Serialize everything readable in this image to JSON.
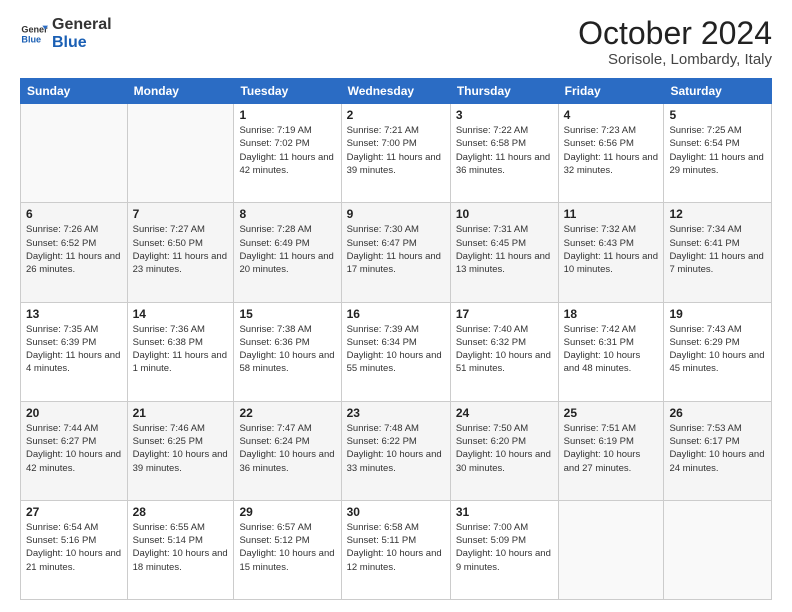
{
  "logo": {
    "line1": "General",
    "line2": "Blue"
  },
  "title": "October 2024",
  "location": "Sorisole, Lombardy, Italy",
  "headers": [
    "Sunday",
    "Monday",
    "Tuesday",
    "Wednesday",
    "Thursday",
    "Friday",
    "Saturday"
  ],
  "weeks": [
    [
      {
        "day": "",
        "info": ""
      },
      {
        "day": "",
        "info": ""
      },
      {
        "day": "1",
        "info": "Sunrise: 7:19 AM\nSunset: 7:02 PM\nDaylight: 11 hours and 42 minutes."
      },
      {
        "day": "2",
        "info": "Sunrise: 7:21 AM\nSunset: 7:00 PM\nDaylight: 11 hours and 39 minutes."
      },
      {
        "day": "3",
        "info": "Sunrise: 7:22 AM\nSunset: 6:58 PM\nDaylight: 11 hours and 36 minutes."
      },
      {
        "day": "4",
        "info": "Sunrise: 7:23 AM\nSunset: 6:56 PM\nDaylight: 11 hours and 32 minutes."
      },
      {
        "day": "5",
        "info": "Sunrise: 7:25 AM\nSunset: 6:54 PM\nDaylight: 11 hours and 29 minutes."
      }
    ],
    [
      {
        "day": "6",
        "info": "Sunrise: 7:26 AM\nSunset: 6:52 PM\nDaylight: 11 hours and 26 minutes."
      },
      {
        "day": "7",
        "info": "Sunrise: 7:27 AM\nSunset: 6:50 PM\nDaylight: 11 hours and 23 minutes."
      },
      {
        "day": "8",
        "info": "Sunrise: 7:28 AM\nSunset: 6:49 PM\nDaylight: 11 hours and 20 minutes."
      },
      {
        "day": "9",
        "info": "Sunrise: 7:30 AM\nSunset: 6:47 PM\nDaylight: 11 hours and 17 minutes."
      },
      {
        "day": "10",
        "info": "Sunrise: 7:31 AM\nSunset: 6:45 PM\nDaylight: 11 hours and 13 minutes."
      },
      {
        "day": "11",
        "info": "Sunrise: 7:32 AM\nSunset: 6:43 PM\nDaylight: 11 hours and 10 minutes."
      },
      {
        "day": "12",
        "info": "Sunrise: 7:34 AM\nSunset: 6:41 PM\nDaylight: 11 hours and 7 minutes."
      }
    ],
    [
      {
        "day": "13",
        "info": "Sunrise: 7:35 AM\nSunset: 6:39 PM\nDaylight: 11 hours and 4 minutes."
      },
      {
        "day": "14",
        "info": "Sunrise: 7:36 AM\nSunset: 6:38 PM\nDaylight: 11 hours and 1 minute."
      },
      {
        "day": "15",
        "info": "Sunrise: 7:38 AM\nSunset: 6:36 PM\nDaylight: 10 hours and 58 minutes."
      },
      {
        "day": "16",
        "info": "Sunrise: 7:39 AM\nSunset: 6:34 PM\nDaylight: 10 hours and 55 minutes."
      },
      {
        "day": "17",
        "info": "Sunrise: 7:40 AM\nSunset: 6:32 PM\nDaylight: 10 hours and 51 minutes."
      },
      {
        "day": "18",
        "info": "Sunrise: 7:42 AM\nSunset: 6:31 PM\nDaylight: 10 hours and 48 minutes."
      },
      {
        "day": "19",
        "info": "Sunrise: 7:43 AM\nSunset: 6:29 PM\nDaylight: 10 hours and 45 minutes."
      }
    ],
    [
      {
        "day": "20",
        "info": "Sunrise: 7:44 AM\nSunset: 6:27 PM\nDaylight: 10 hours and 42 minutes."
      },
      {
        "day": "21",
        "info": "Sunrise: 7:46 AM\nSunset: 6:25 PM\nDaylight: 10 hours and 39 minutes."
      },
      {
        "day": "22",
        "info": "Sunrise: 7:47 AM\nSunset: 6:24 PM\nDaylight: 10 hours and 36 minutes."
      },
      {
        "day": "23",
        "info": "Sunrise: 7:48 AM\nSunset: 6:22 PM\nDaylight: 10 hours and 33 minutes."
      },
      {
        "day": "24",
        "info": "Sunrise: 7:50 AM\nSunset: 6:20 PM\nDaylight: 10 hours and 30 minutes."
      },
      {
        "day": "25",
        "info": "Sunrise: 7:51 AM\nSunset: 6:19 PM\nDaylight: 10 hours and 27 minutes."
      },
      {
        "day": "26",
        "info": "Sunrise: 7:53 AM\nSunset: 6:17 PM\nDaylight: 10 hours and 24 minutes."
      }
    ],
    [
      {
        "day": "27",
        "info": "Sunrise: 6:54 AM\nSunset: 5:16 PM\nDaylight: 10 hours and 21 minutes."
      },
      {
        "day": "28",
        "info": "Sunrise: 6:55 AM\nSunset: 5:14 PM\nDaylight: 10 hours and 18 minutes."
      },
      {
        "day": "29",
        "info": "Sunrise: 6:57 AM\nSunset: 5:12 PM\nDaylight: 10 hours and 15 minutes."
      },
      {
        "day": "30",
        "info": "Sunrise: 6:58 AM\nSunset: 5:11 PM\nDaylight: 10 hours and 12 minutes."
      },
      {
        "day": "31",
        "info": "Sunrise: 7:00 AM\nSunset: 5:09 PM\nDaylight: 10 hours and 9 minutes."
      },
      {
        "day": "",
        "info": ""
      },
      {
        "day": "",
        "info": ""
      }
    ]
  ]
}
